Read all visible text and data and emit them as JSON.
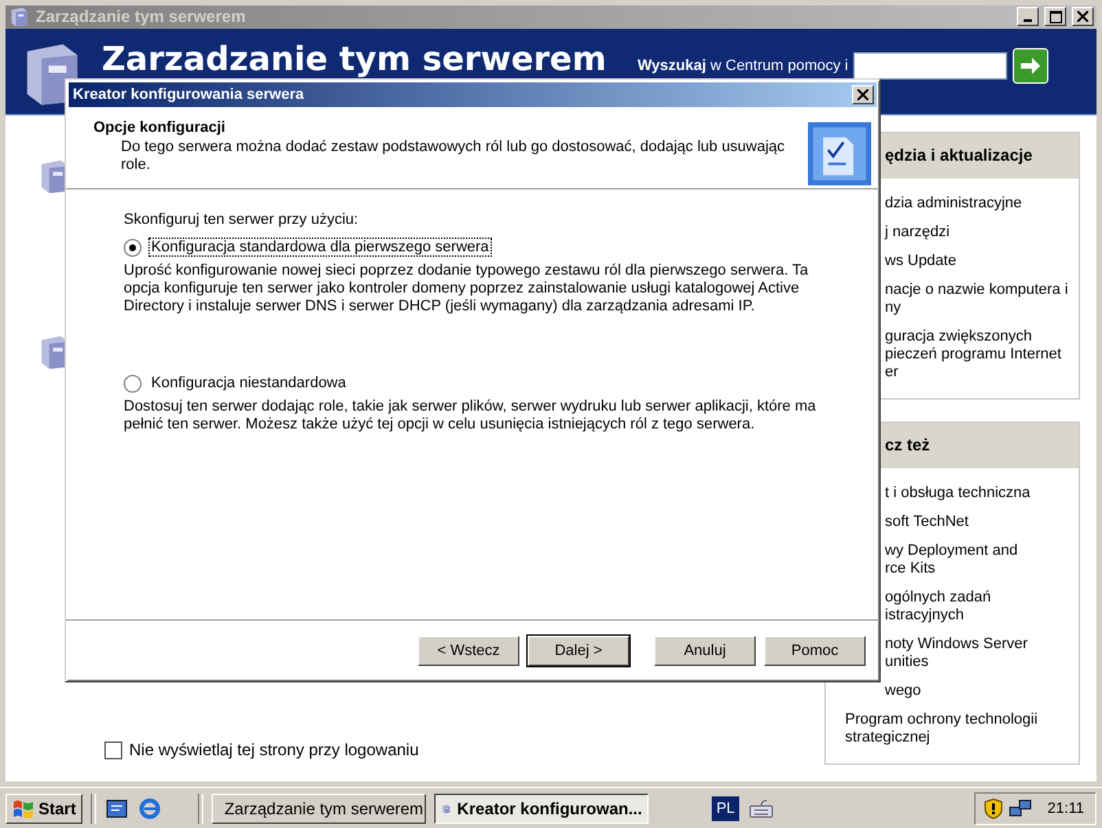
{
  "window": {
    "title": "Zarządzanie tym serwerem"
  },
  "header": {
    "title": "Zarzadzanie tym serwerem",
    "search_label": "**Wyszukaj** w Centrum pomocy i"
  },
  "right_panel": {
    "sections": [
      {
        "title": "ędzia i aktualizacje",
        "items": [
          "dzia administracyjne",
          "j narzędzi",
          "ws Update",
          "nacje o nazwie komputera i\nny",
          "guracja zwiększonych\npieczeń programu Internet\ner"
        ]
      },
      {
        "title": "cz też",
        "items": [
          "t i obsługa techniczna",
          "soft TechNet",
          "wy Deployment and\nrce Kits",
          "ogólnych zadań\nistracyjnych",
          "noty Windows Server\nunities",
          "wego"
        ]
      }
    ],
    "footer_item": "Program ochrony technologii strategicznej"
  },
  "startup_checkbox": {
    "label": "Nie wyświetlaj tej strony przy logowaniu",
    "checked": false
  },
  "dialog": {
    "title": "Kreator konfigurowania serwera",
    "heading": "Opcje konfiguracji",
    "subtitle": "Do tego serwera można dodać zestaw podstawowych ról lub go dostosować, dodając lub usuwając role.",
    "prompt": "Skonfiguruj ten serwer przy użyciu:",
    "options": [
      {
        "label": "Konfiguracja standardowa dla pierwszego serwera",
        "selected": true,
        "description": "Uprość konfigurowanie nowej sieci poprzez dodanie typowego zestawu ról dla pierwszego serwera. Ta opcja konfiguruje ten serwer jako kontroler domeny poprzez zainstalowanie usługi katalogowej Active Directory i instaluje serwer DNS i serwer DHCP (jeśli wymagany) dla zarządzania adresami IP."
      },
      {
        "label": "Konfiguracja niestandardowa",
        "selected": false,
        "description": "Dostosuj ten serwer dodając role, takie jak serwer plików, serwer wydruku lub serwer aplikacji, które ma pełnić ten serwer. Możesz także użyć tej opcji w celu usunięcia istniejących ról z tego serwera."
      }
    ],
    "buttons": [
      {
        "label": "< Wstecz",
        "default": false
      },
      {
        "label": "Dalej >",
        "default": true
      },
      {
        "label": "Anuluj",
        "default": false
      },
      {
        "label": "Pomoc",
        "default": false
      }
    ]
  },
  "taskbar": {
    "start": "Start",
    "tasks": [
      {
        "label": "Zarządzanie tym serwerem",
        "selected": false
      },
      {
        "label": "Kreator konfigurowan...",
        "selected": true
      }
    ],
    "language": "PL",
    "clock": "21:11"
  }
}
